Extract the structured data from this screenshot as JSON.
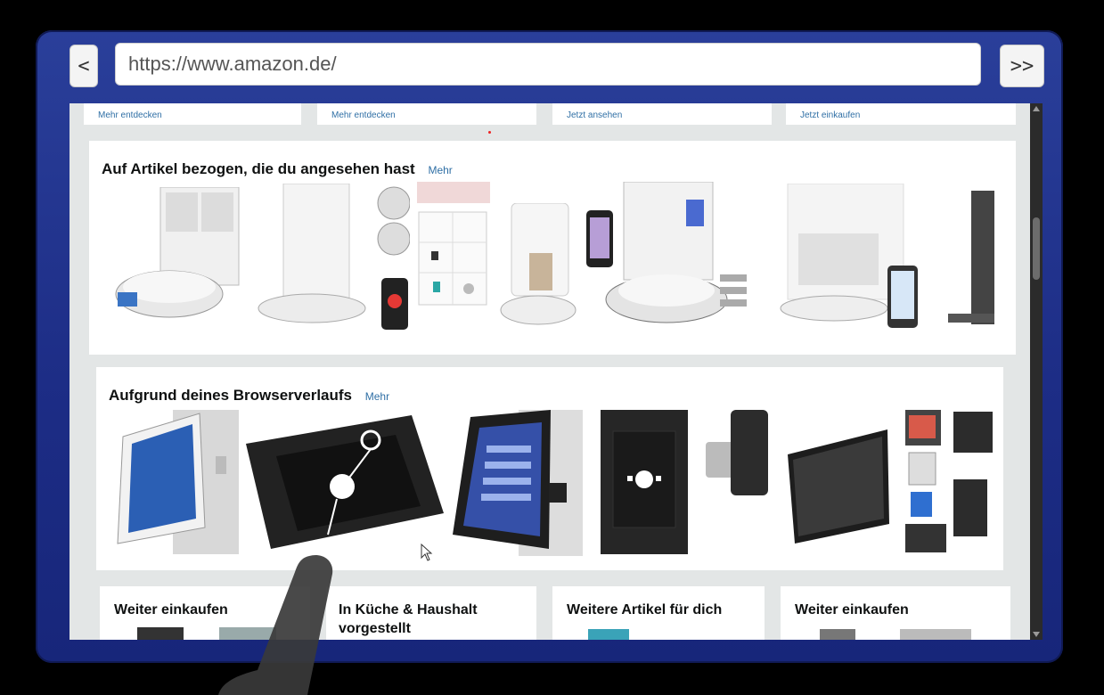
{
  "browser": {
    "back_label": "<",
    "forward_label": ">>",
    "url": "https://www.amazon.de/"
  },
  "top_cards": [
    {
      "link": "Mehr entdecken"
    },
    {
      "link": "Mehr entdecken"
    },
    {
      "link": "Jetzt ansehen"
    },
    {
      "link": "Jetzt einkaufen"
    }
  ],
  "section_viewed": {
    "title": "Auf Artikel bezogen, die du angesehen hast",
    "more": "Mehr"
  },
  "section_history": {
    "title": "Aufgrund deines Browserverlaufs",
    "more": "Mehr"
  },
  "bottom_cards": [
    {
      "title": "Weiter einkaufen"
    },
    {
      "title": "In Küche & Haushalt vorgestellt"
    },
    {
      "title": "Weitere Artikel für dich"
    },
    {
      "title": "Weiter einkaufen"
    }
  ],
  "colors": {
    "frame": "#1d2d86",
    "link": "#2f6fa5",
    "page_bg": "#e3e6e6"
  }
}
